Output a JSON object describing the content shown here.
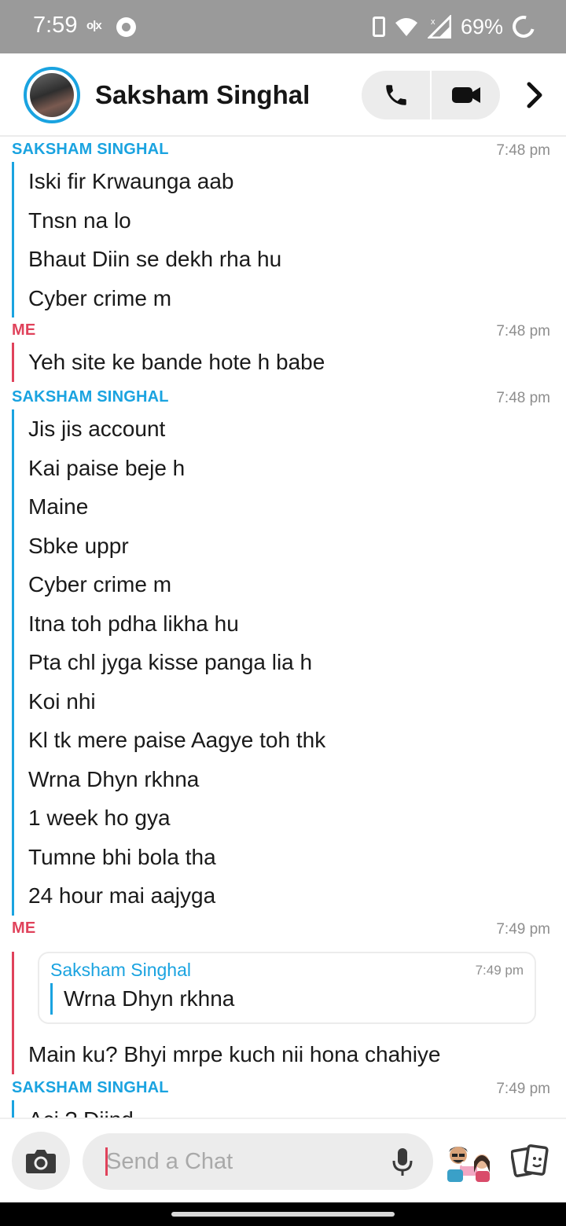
{
  "status_bar": {
    "time": "7:59",
    "ox_label": "o|x",
    "battery_percent": "69%",
    "icons": [
      "olx-icon",
      "chrome-icon",
      "vibrate-icon",
      "wifi-icon",
      "signal-icon",
      "battery-ring-icon"
    ]
  },
  "header": {
    "contact_name": "Saksham Singhal",
    "icons": [
      "avatar",
      "phone-icon",
      "video-icon",
      "chevron-right-icon"
    ]
  },
  "chat": {
    "groups": [
      {
        "sender": "SAKSHAM SINGHAL",
        "time": "7:48 pm",
        "messages": [
          "Iski fir Krwaunga aab",
          "Tnsn na lo",
          "Bhaut Diin se dekh rha hu",
          "Cyber crime m"
        ]
      },
      {
        "sender": "ME",
        "time": "7:48 pm",
        "messages": [
          "Yeh site ke bande hote h babe"
        ]
      },
      {
        "sender": "SAKSHAM SINGHAL",
        "time": "7:48 pm",
        "messages": [
          "Jis jis account",
          "Kai paise beje h",
          "Maine",
          "Sbke uppr",
          "Cyber crime m",
          "Itna toh pdha likha hu",
          "Pta chl jyga kisse panga lia h",
          "Koi nhi",
          "Kl tk mere paise Aagye toh thk",
          "Wrna Dhyn rkhna",
          "1 week ho gya",
          "Tumne bhi bola tha",
          "24 hour mai aajyga"
        ]
      },
      {
        "sender": "ME",
        "time": "7:49 pm",
        "quote": {
          "name": "Saksham Singhal",
          "time": "7:49 pm",
          "text": "Wrna Dhyn rkhna"
        },
        "messages": [
          "Main ku? Bhyi mrpe kuch nii hona chahiye"
        ]
      },
      {
        "sender": "SAKSHAM SINGHAL",
        "time": "7:49 pm",
        "messages": [
          "Acj ? Diind"
        ]
      }
    ]
  },
  "input_bar": {
    "placeholder": "Send a Chat",
    "icons": [
      "camera-icon",
      "mic-icon",
      "bitmoji-icon",
      "cards-icon"
    ]
  },
  "colors": {
    "them": "#1aa3e0",
    "me": "#e0425b",
    "status_bar_bg": "#9a9a9a",
    "pill_bg": "#ececec"
  }
}
